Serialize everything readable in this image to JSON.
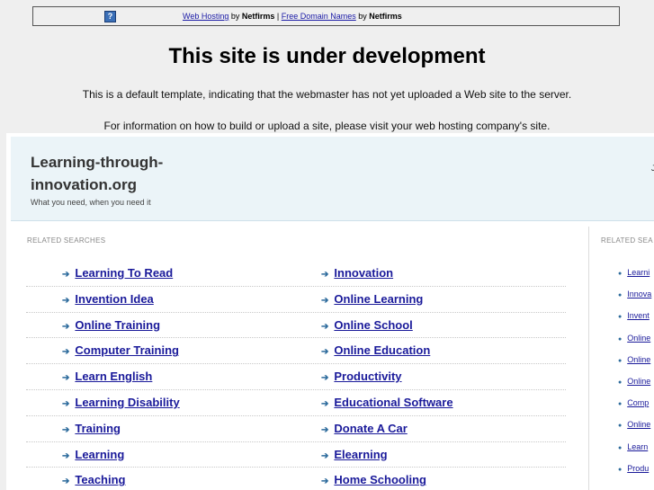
{
  "topbar": {
    "icon": "question-icon",
    "link1": "Web Hosting",
    "by1": " by ",
    "brand1": "Netfirms",
    "sep": " | ",
    "link2": "Free Domain Names",
    "by2": " by ",
    "brand2": "Netfirms"
  },
  "heading": "This site is under development",
  "message1": "This is a default template, indicating that the webmaster has not yet uploaded a Web site to the server.",
  "message2": "For information on how to build or upload a site, please visit your web hosting company's site.",
  "site": {
    "title": "Learning-through-innovation.org",
    "tagline": "What you need, when you need it",
    "right_fragment": "J"
  },
  "related_label": "RELATED SEARCHES",
  "related_label_right": "RELATED SEA",
  "left_col": [
    "Learning To Read",
    "Invention Idea",
    "Online Training",
    "Computer Training",
    "Learn English",
    "Learning Disability",
    "Training",
    "Learning",
    "Teaching"
  ],
  "right_col": [
    "Innovation",
    "Online Learning",
    "Online School",
    "Online Education",
    "Productivity",
    "Educational Software",
    "Donate A Car",
    "Elearning",
    "Home Schooling"
  ],
  "side_list": [
    "Learni",
    "Innova",
    "Invent",
    "Online",
    "Online",
    "Online",
    "Comp",
    "Online",
    "Learn",
    "Produ"
  ]
}
